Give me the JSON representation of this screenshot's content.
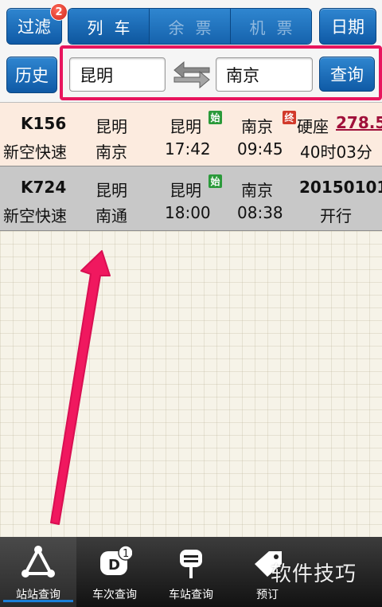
{
  "toolbar": {
    "filter_label": "过滤",
    "filter_badge": "2",
    "history_label": "历史",
    "date_label": "日期",
    "query_label": "查询",
    "tabs": [
      {
        "label": "列车",
        "active": true
      },
      {
        "label": "余票",
        "active": false
      },
      {
        "label": "机票",
        "active": false
      }
    ],
    "from_station": "昆明",
    "to_station": "南京",
    "swap_icon": "swap-arrows-icon"
  },
  "results": [
    {
      "train_no": "K156",
      "train_type": "新空快速",
      "origin": "昆明",
      "terminus": "南京",
      "depart_station": "昆明",
      "depart_tag": "始",
      "depart_time": "17:42",
      "arrive_station": "南京",
      "arrive_tag": "终",
      "arrive_time": "09:45",
      "seat_type": "硬座",
      "price": "278.5",
      "duration": "40时03分"
    },
    {
      "train_no": "K724",
      "train_type": "新空快速",
      "origin": "昆明",
      "terminus": "南通",
      "depart_station": "昆明",
      "depart_tag": "始",
      "depart_time": "18:00",
      "arrive_station": "南京",
      "arrive_time": "08:38",
      "run_date": "20150101",
      "run_status": "开行"
    }
  ],
  "bottom_nav": [
    {
      "label": "站站查询",
      "icon": "route-triangle-icon",
      "active": true
    },
    {
      "label": "车次查询",
      "icon": "train-number-icon",
      "badge": "1",
      "active": false
    },
    {
      "label": "车站查询",
      "icon": "station-sign-icon",
      "active": false
    },
    {
      "label": "预订",
      "icon": "ticket-tag-icon",
      "active": false
    }
  ],
  "watermark": "软件技巧",
  "colors": {
    "accent_blue": "#0f5aa6",
    "highlight_pink": "#e8155e",
    "price_red": "#a0103a",
    "row_highlight": "#fcebdf",
    "row_gray": "#c8c8c8"
  }
}
